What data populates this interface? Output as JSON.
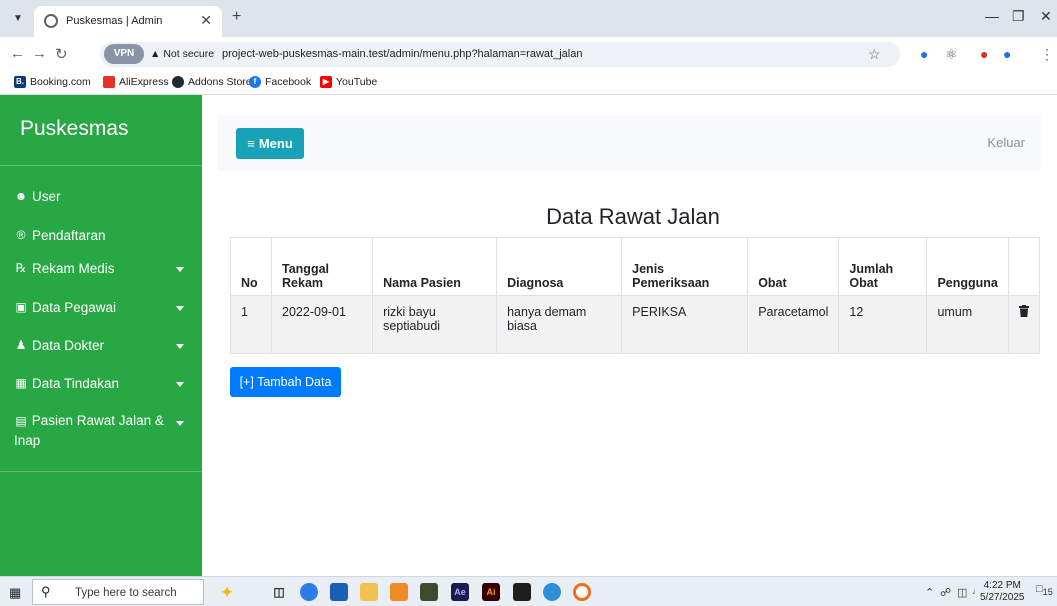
{
  "browser": {
    "tab_title": "Puskesmas | Admin",
    "secure_label": "Not secure",
    "url": "project-web-puskesmas-main.test/admin/menu.php?halaman=rawat_jalan",
    "vpn_label": "VPN",
    "bookmarks": [
      "Booking.com",
      "AliExpress",
      "Addons Store",
      "Facebook",
      "YouTube"
    ]
  },
  "sidebar": {
    "brand": "Puskesmas",
    "items": [
      {
        "label": "User",
        "icon": "users-icon"
      },
      {
        "label": "Pendaftaran",
        "icon": "registered-icon"
      },
      {
        "label": "Rekam Medis",
        "icon": "medical-record-icon"
      },
      {
        "label": "Data Pegawai",
        "icon": "id-card-icon"
      },
      {
        "label": "Data Dokter",
        "icon": "doctor-icon"
      },
      {
        "label": "Data Tindakan",
        "icon": "medkit-icon"
      },
      {
        "label": "Pasien Rawat Jalan &",
        "label2": "Inap",
        "icon": "bed-icon"
      }
    ]
  },
  "topnav": {
    "menu_label": "Menu",
    "logout_label": "Keluar"
  },
  "main": {
    "title": "Data Rawat Jalan",
    "add_button": "[+] Tambah Data"
  },
  "table": {
    "headers": [
      "No",
      "Tanggal Rekam",
      "Nama Pasien",
      "Diagnosa",
      "Jenis Pemeriksaan",
      "Obat",
      "Jumlah Obat",
      "Pengguna",
      ""
    ],
    "rows": [
      {
        "no": "1",
        "tanggal": "2022-09-01",
        "nama": "rizki bayu septiabudi",
        "diagnosa": "hanya demam biasa",
        "jenis": "PERIKSA",
        "obat": "Paracetamol",
        "jumlah": "12",
        "pengguna": "umum"
      }
    ]
  },
  "taskbar": {
    "search_placeholder": "Type here to search",
    "time": "4:22 PM",
    "date": "5/27/2025",
    "notification_count": "15"
  }
}
